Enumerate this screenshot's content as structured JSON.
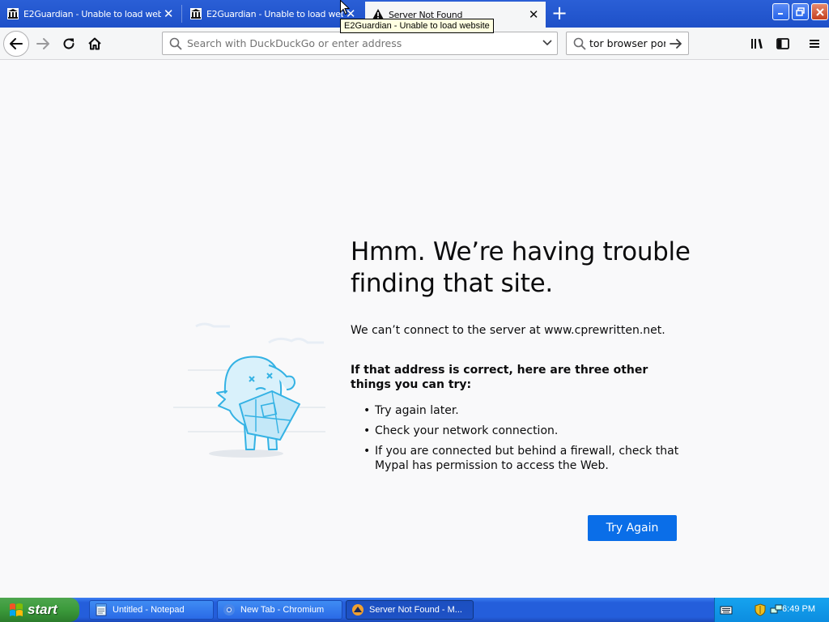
{
  "tabs": [
    {
      "title": "E2Guardian - Unable to load website",
      "active": false,
      "icon": "museum-icon"
    },
    {
      "title": "E2Guardian - Unable to load website",
      "active": false,
      "icon": "museum-icon"
    },
    {
      "title": "Server Not Found",
      "active": true,
      "icon": "warning-icon"
    }
  ],
  "tooltip": "E2Guardian - Unable to load website",
  "navbar": {
    "url_placeholder": "Search with DuckDuckGo or enter address",
    "url_value": "",
    "search_value": "tor browser por"
  },
  "error": {
    "title": "Hmm. We’re having trouble finding that site.",
    "description": "We can’t connect to the server at www.cprewritten.net.",
    "subhead": "If that address is correct, here are three other things you can try:",
    "suggestions": [
      "Try again later.",
      "Check your network connection.",
      "If you are connected but behind a firewall, check that Mypal has permission to access the Web."
    ],
    "button": "Try Again"
  },
  "taskbar": {
    "start_label": "start",
    "tasks": [
      {
        "label": "Untitled - Notepad",
        "icon": "notepad-icon"
      },
      {
        "label": "New Tab - Chromium",
        "icon": "chromium-icon"
      },
      {
        "label": "Server Not Found - M...",
        "icon": "mypal-icon",
        "active": true
      }
    ],
    "clock": "6:49 PM"
  },
  "colors": {
    "accent": "#0a6ee8",
    "tabstrip": "#2a5fd6",
    "taskbar": "#245edb",
    "start": "#3b9a3b"
  }
}
